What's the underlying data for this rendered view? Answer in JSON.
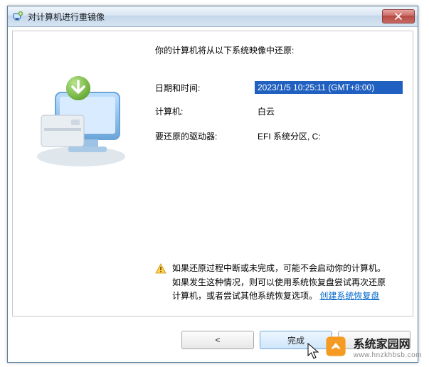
{
  "window": {
    "title": "对计算机进行重镜像"
  },
  "intro": "你的计算机将从以下系统映像中还原:",
  "fields": {
    "datetime_label": "日期和时间:",
    "datetime_value": "2023/1/5 10:25:11 (GMT+8:00)",
    "computer_label": "计算机:",
    "computer_value": "白云",
    "drives_label": "要还原的驱动器:",
    "drives_value": "EFI 系统分区, C:"
  },
  "warning": {
    "line1": "如果还原过程中断或未完成，可能不会启动你的计算机。",
    "line2_a": "如果发生这种情况，则可以使用系统恢复盘尝试再次还原",
    "line2_b": "计算机，或者尝试其他系统恢复选项。",
    "link": "创建系统恢复盘"
  },
  "buttons": {
    "back": "<",
    "finish": "完成",
    "cancel": ""
  },
  "watermark": {
    "name": "系统家园网",
    "url": "www.hnzkhbsb.com"
  }
}
